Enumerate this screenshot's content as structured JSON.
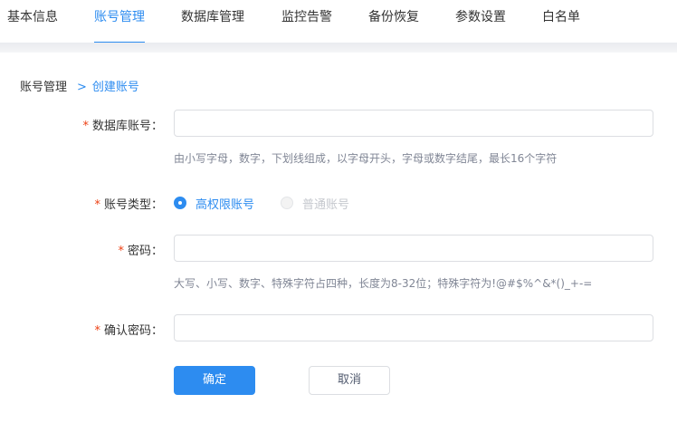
{
  "tabs": [
    {
      "label": "基本信息",
      "active": false
    },
    {
      "label": "账号管理",
      "active": true
    },
    {
      "label": "数据库管理",
      "active": false
    },
    {
      "label": "监控告警",
      "active": false
    },
    {
      "label": "备份恢复",
      "active": false
    },
    {
      "label": "参数设置",
      "active": false
    },
    {
      "label": "白名单",
      "active": false
    }
  ],
  "breadcrumb": {
    "root": "账号管理",
    "separator": ">",
    "current": "创建账号"
  },
  "form": {
    "required_mark": "*",
    "db_account": {
      "label": "数据库账号：",
      "value": "",
      "placeholder": "",
      "hint": "由小写字母，数字，下划线组成，以字母开头，字母或数字结尾，最长16个字符"
    },
    "account_type": {
      "label": "账号类型：",
      "options": [
        {
          "label": "高权限账号",
          "checked": true,
          "disabled": false
        },
        {
          "label": "普通账号",
          "checked": false,
          "disabled": true
        }
      ]
    },
    "password": {
      "label": "密码：",
      "value": "",
      "placeholder": "",
      "hint": "大写、小写、数字、特殊字符占四种，长度为8-32位；特殊字符为!@#$%^&*()_+-="
    },
    "confirm_password": {
      "label": "确认密码：",
      "value": "",
      "placeholder": ""
    }
  },
  "buttons": {
    "confirm": "确定",
    "cancel": "取消"
  },
  "colors": {
    "primary": "#2d8cf0",
    "required": "#ed4014",
    "hint": "#808695",
    "disabled": "#c5c8ce"
  }
}
